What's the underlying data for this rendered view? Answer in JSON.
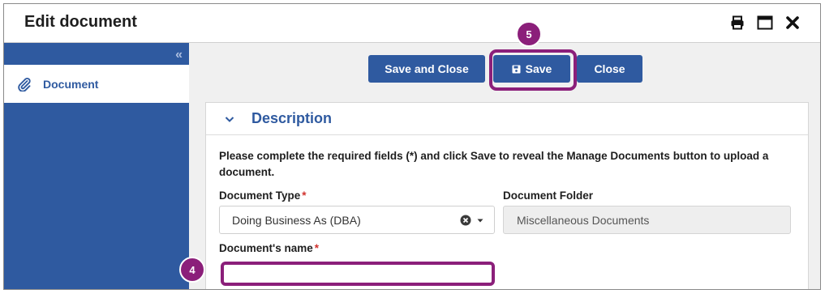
{
  "window": {
    "title": "Edit document",
    "icons": [
      "printer-icon",
      "maximize-icon",
      "close-icon"
    ]
  },
  "sidebar": {
    "collapse_glyph": "«",
    "items": [
      {
        "label": "Document",
        "icon": "paperclip-icon"
      }
    ]
  },
  "toolbar": {
    "save_close_label": "Save and Close",
    "save_label": "Save",
    "close_label": "Close"
  },
  "panel": {
    "title": "Description",
    "instructions": "Please complete the required fields (*) and click Save to reveal the Manage Documents button to upload a document."
  },
  "fields": {
    "document_type": {
      "label": "Document Type",
      "required_mark": "*",
      "value": "Doing Business As (DBA)"
    },
    "document_folder": {
      "label": "Document Folder",
      "value": "Miscellaneous Documents"
    },
    "document_name": {
      "label": "Document's name",
      "required_mark": "*",
      "value": ""
    }
  },
  "annotations": {
    "step_save": "5",
    "step_name": "4"
  },
  "colors": {
    "primary": "#2f5aa0",
    "highlight": "#8b1f7a",
    "required": "#d0312d"
  }
}
